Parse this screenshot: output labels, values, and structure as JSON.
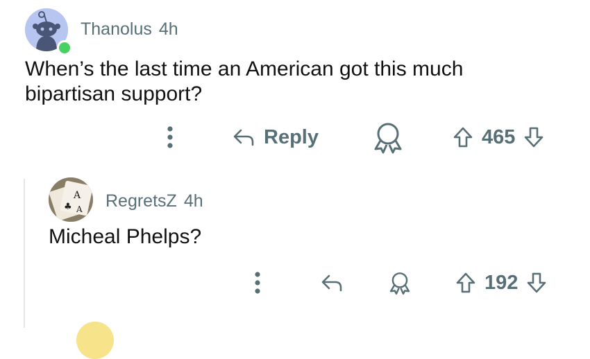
{
  "comment1": {
    "username": "Thanolus",
    "time": "4h",
    "body_lines": [
      "When’s the last time an American got this much",
      "bipartisan support?"
    ],
    "reply_label": "Reply",
    "score": "465",
    "avatar_icon": "snoo-avatar-icon",
    "online_status_color": "#46d160"
  },
  "comment2": {
    "username": "RegretsZ",
    "time": "4h",
    "body": "Micheal Phelps?",
    "score": "192",
    "avatar_icon": "playing-cards-avatar-icon"
  },
  "colors": {
    "meta_text": "#576f76",
    "body_text": "#111111",
    "thread_line": "#e5e5e5"
  }
}
